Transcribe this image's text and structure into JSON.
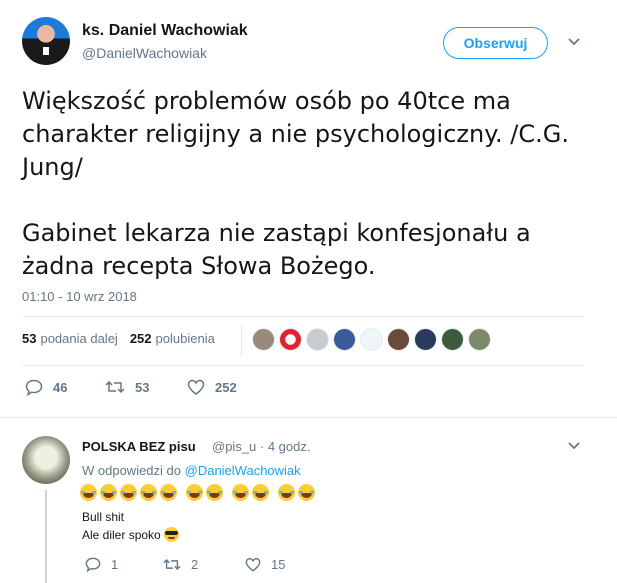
{
  "tweet": {
    "author_name": "ks. Daniel Wachowiak",
    "author_handle": "@DanielWachowiak",
    "follow_label": "Obserwuj",
    "text": "Większość problemów osób po 40tce ma\ncharakter religijny a nie psychologiczny. /C.G.\nJung/\n\nGabinet lekarza nie zastąpi konfesjonału a\nżadna recepta Słowa Bożego.",
    "timestamp": "01:10 - 10 wrz 2018",
    "retweets_count": "53",
    "retweets_label": "podania dalej",
    "likes_count": "252",
    "likes_label": "polubienia",
    "actions": {
      "replies": "46",
      "retweets": "53",
      "likes": "252"
    }
  },
  "reply": {
    "author_name": "POLSKA BEZ pisu",
    "author_handle": "@pis_u",
    "time": "4 godz.",
    "meta": "@pis_u · 4 godz.",
    "reply_to_prefix": "W odpowiedzi do",
    "reply_to_handle": "@DanielWachowiak",
    "emoji_count": 11,
    "line1": "Bull shit",
    "line2": "Ale diler spoko",
    "actions": {
      "replies": "1",
      "retweets": "2",
      "likes": "15"
    }
  },
  "colors": {
    "accent": "#1da1f2",
    "secondary_text": "#657786",
    "divider": "#e6ecf0"
  }
}
